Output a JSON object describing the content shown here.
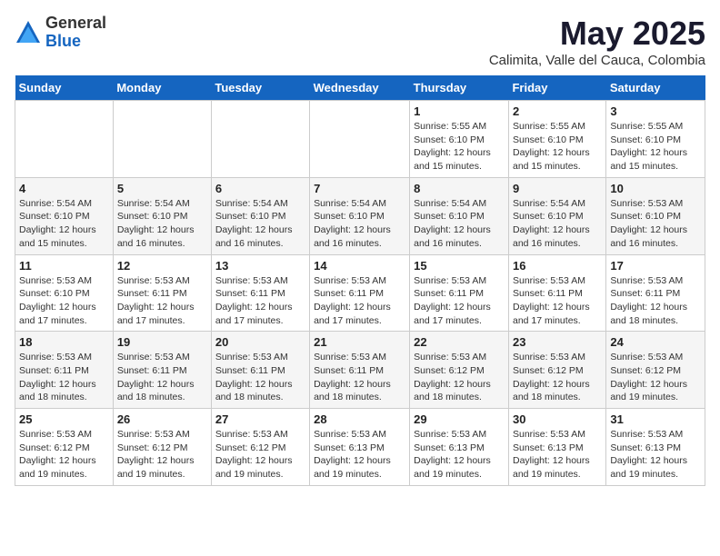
{
  "logo": {
    "general": "General",
    "blue": "Blue"
  },
  "title": "May 2025",
  "subtitle": "Calimita, Valle del Cauca, Colombia",
  "days_of_week": [
    "Sunday",
    "Monday",
    "Tuesday",
    "Wednesday",
    "Thursday",
    "Friday",
    "Saturday"
  ],
  "weeks": [
    [
      {
        "day": "",
        "info": ""
      },
      {
        "day": "",
        "info": ""
      },
      {
        "day": "",
        "info": ""
      },
      {
        "day": "",
        "info": ""
      },
      {
        "day": "1",
        "info": "Sunrise: 5:55 AM\nSunset: 6:10 PM\nDaylight: 12 hours\nand 15 minutes."
      },
      {
        "day": "2",
        "info": "Sunrise: 5:55 AM\nSunset: 6:10 PM\nDaylight: 12 hours\nand 15 minutes."
      },
      {
        "day": "3",
        "info": "Sunrise: 5:55 AM\nSunset: 6:10 PM\nDaylight: 12 hours\nand 15 minutes."
      }
    ],
    [
      {
        "day": "4",
        "info": "Sunrise: 5:54 AM\nSunset: 6:10 PM\nDaylight: 12 hours\nand 15 minutes."
      },
      {
        "day": "5",
        "info": "Sunrise: 5:54 AM\nSunset: 6:10 PM\nDaylight: 12 hours\nand 16 minutes."
      },
      {
        "day": "6",
        "info": "Sunrise: 5:54 AM\nSunset: 6:10 PM\nDaylight: 12 hours\nand 16 minutes."
      },
      {
        "day": "7",
        "info": "Sunrise: 5:54 AM\nSunset: 6:10 PM\nDaylight: 12 hours\nand 16 minutes."
      },
      {
        "day": "8",
        "info": "Sunrise: 5:54 AM\nSunset: 6:10 PM\nDaylight: 12 hours\nand 16 minutes."
      },
      {
        "day": "9",
        "info": "Sunrise: 5:54 AM\nSunset: 6:10 PM\nDaylight: 12 hours\nand 16 minutes."
      },
      {
        "day": "10",
        "info": "Sunrise: 5:53 AM\nSunset: 6:10 PM\nDaylight: 12 hours\nand 16 minutes."
      }
    ],
    [
      {
        "day": "11",
        "info": "Sunrise: 5:53 AM\nSunset: 6:10 PM\nDaylight: 12 hours\nand 17 minutes."
      },
      {
        "day": "12",
        "info": "Sunrise: 5:53 AM\nSunset: 6:11 PM\nDaylight: 12 hours\nand 17 minutes."
      },
      {
        "day": "13",
        "info": "Sunrise: 5:53 AM\nSunset: 6:11 PM\nDaylight: 12 hours\nand 17 minutes."
      },
      {
        "day": "14",
        "info": "Sunrise: 5:53 AM\nSunset: 6:11 PM\nDaylight: 12 hours\nand 17 minutes."
      },
      {
        "day": "15",
        "info": "Sunrise: 5:53 AM\nSunset: 6:11 PM\nDaylight: 12 hours\nand 17 minutes."
      },
      {
        "day": "16",
        "info": "Sunrise: 5:53 AM\nSunset: 6:11 PM\nDaylight: 12 hours\nand 17 minutes."
      },
      {
        "day": "17",
        "info": "Sunrise: 5:53 AM\nSunset: 6:11 PM\nDaylight: 12 hours\nand 18 minutes."
      }
    ],
    [
      {
        "day": "18",
        "info": "Sunrise: 5:53 AM\nSunset: 6:11 PM\nDaylight: 12 hours\nand 18 minutes."
      },
      {
        "day": "19",
        "info": "Sunrise: 5:53 AM\nSunset: 6:11 PM\nDaylight: 12 hours\nand 18 minutes."
      },
      {
        "day": "20",
        "info": "Sunrise: 5:53 AM\nSunset: 6:11 PM\nDaylight: 12 hours\nand 18 minutes."
      },
      {
        "day": "21",
        "info": "Sunrise: 5:53 AM\nSunset: 6:11 PM\nDaylight: 12 hours\nand 18 minutes."
      },
      {
        "day": "22",
        "info": "Sunrise: 5:53 AM\nSunset: 6:12 PM\nDaylight: 12 hours\nand 18 minutes."
      },
      {
        "day": "23",
        "info": "Sunrise: 5:53 AM\nSunset: 6:12 PM\nDaylight: 12 hours\nand 18 minutes."
      },
      {
        "day": "24",
        "info": "Sunrise: 5:53 AM\nSunset: 6:12 PM\nDaylight: 12 hours\nand 19 minutes."
      }
    ],
    [
      {
        "day": "25",
        "info": "Sunrise: 5:53 AM\nSunset: 6:12 PM\nDaylight: 12 hours\nand 19 minutes."
      },
      {
        "day": "26",
        "info": "Sunrise: 5:53 AM\nSunset: 6:12 PM\nDaylight: 12 hours\nand 19 minutes."
      },
      {
        "day": "27",
        "info": "Sunrise: 5:53 AM\nSunset: 6:12 PM\nDaylight: 12 hours\nand 19 minutes."
      },
      {
        "day": "28",
        "info": "Sunrise: 5:53 AM\nSunset: 6:13 PM\nDaylight: 12 hours\nand 19 minutes."
      },
      {
        "day": "29",
        "info": "Sunrise: 5:53 AM\nSunset: 6:13 PM\nDaylight: 12 hours\nand 19 minutes."
      },
      {
        "day": "30",
        "info": "Sunrise: 5:53 AM\nSunset: 6:13 PM\nDaylight: 12 hours\nand 19 minutes."
      },
      {
        "day": "31",
        "info": "Sunrise: 5:53 AM\nSunset: 6:13 PM\nDaylight: 12 hours\nand 19 minutes."
      }
    ]
  ]
}
